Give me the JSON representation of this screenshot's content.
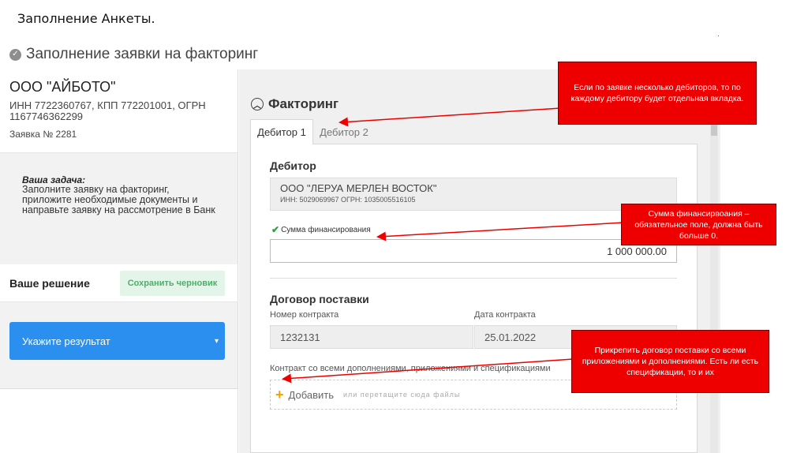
{
  "slide": {
    "title": "Заполнение Анкеты.",
    "dot": "."
  },
  "header": {
    "title": "Заполнение заявки на факторинг"
  },
  "company": {
    "name": "ООО \"АЙБОТО\"",
    "ids": "ИНН 7722360767, КПП 772201001, ОГРН 1167746362299",
    "application": "Заявка № 2281"
  },
  "task": {
    "title": "Ваша задача:",
    "text": "Заполните заявку на факторинг, приложите необходимые документы и направьте заявку на рассмотрение в Банк"
  },
  "decision": {
    "label": "Ваше решение",
    "save_draft": "Сохранить черновик",
    "result_placeholder": "Укажите результат",
    "result_arrow": "▾"
  },
  "factoring": {
    "section_title": "Факторинг",
    "tabs": [
      {
        "label": "Дебитор 1"
      },
      {
        "label": "Дебитор 2"
      }
    ],
    "debtor": {
      "label": "Дебитор",
      "name": "ООО \"ЛЕРУА МЕРЛЕН ВОСТОК\"",
      "ids": "ИНН: 5029069967 ОГРН: 1035005516105"
    },
    "amount": {
      "label": "Сумма финансирования",
      "value": "1 000 000.00"
    },
    "contract": {
      "label": "Договор поставки",
      "number_label": "Номер контракта",
      "number_value": "1232131",
      "date_label": "Дата контракта",
      "date_value": "25.01.2022",
      "attach_label": "Контракт со всеми дополнениями, приложениями и спецификациями",
      "add_label": "Добавить",
      "drop_hint": "или перетащите сюда файлы"
    }
  },
  "callouts": {
    "tabs_note": "Если по заявке несколько дебиторов, то по каждому дебитору будет отдельная вкладка.",
    "amount_note": "Сумма финансирвоания – обязательное поле, должна быть больше 0.",
    "contract_note": "Прикрепить договор поставки со всеми приложениями и дополнениями. Есть ли есть спецификации, то и их"
  },
  "colors": {
    "accent_blue": "#2b8ff0",
    "callout_red": "#ee0000",
    "draft_green": "#4caf6a",
    "add_orange": "#f0a500"
  },
  "icons": {
    "header": "check-circle-icon",
    "section": "chevron-up-circle-icon",
    "amount": "checkmark-icon",
    "add": "plus-icon",
    "select": "caret-down-icon"
  }
}
